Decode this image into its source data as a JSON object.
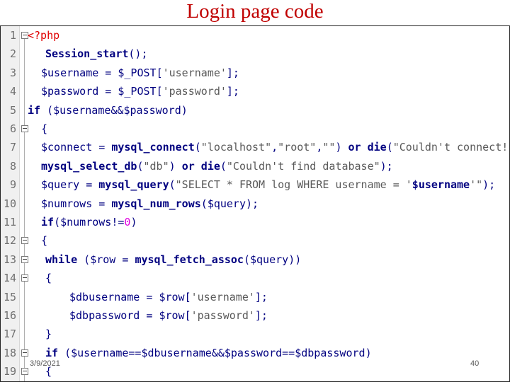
{
  "title": "Login page code",
  "footer": {
    "date": "3/9/2021",
    "page": "40"
  },
  "lines": [
    {
      "n": "1",
      "indent": 0,
      "fold": true,
      "tokens": [
        [
          "php",
          "<?php"
        ]
      ]
    },
    {
      "n": "2",
      "indent": 2,
      "fold": false,
      "tokens": [
        [
          "fn",
          "Session_start"
        ],
        [
          "op",
          "();"
        ]
      ]
    },
    {
      "n": "3",
      "indent": 1,
      "fold": false,
      "tokens": [
        [
          "var",
          "$username"
        ],
        [
          "op",
          " = "
        ],
        [
          "var",
          "$_POST"
        ],
        [
          "op",
          "["
        ],
        [
          "str",
          "'username'"
        ],
        [
          "op",
          "];"
        ]
      ]
    },
    {
      "n": "4",
      "indent": 1,
      "fold": false,
      "tokens": [
        [
          "var",
          "$password"
        ],
        [
          "op",
          " = "
        ],
        [
          "var",
          "$_POST"
        ],
        [
          "op",
          "["
        ],
        [
          "str",
          "'password'"
        ],
        [
          "op",
          "];"
        ]
      ]
    },
    {
      "n": "5",
      "indent": 0,
      "fold": false,
      "tokens": [
        [
          "kw",
          "if"
        ],
        [
          "op",
          " ("
        ],
        [
          "var",
          "$username"
        ],
        [
          "op",
          "&&"
        ],
        [
          "var",
          "$password"
        ],
        [
          "op",
          ")"
        ]
      ]
    },
    {
      "n": "6",
      "indent": 1,
      "fold": true,
      "tokens": [
        [
          "op",
          "{"
        ]
      ]
    },
    {
      "n": "7",
      "indent": 1,
      "fold": false,
      "tokens": [
        [
          "var",
          "$connect"
        ],
        [
          "op",
          " = "
        ],
        [
          "fn",
          "mysql_connect"
        ],
        [
          "op",
          "("
        ],
        [
          "str",
          "\"localhost\""
        ],
        [
          "op",
          ","
        ],
        [
          "str",
          "\"root\""
        ],
        [
          "op",
          ","
        ],
        [
          "str",
          "\"\""
        ],
        [
          "op",
          ") "
        ],
        [
          "kw",
          "or"
        ],
        [
          "op",
          " "
        ],
        [
          "fn",
          "die"
        ],
        [
          "op",
          "("
        ],
        [
          "str",
          "\"Couldn't connect!\""
        ],
        [
          "op",
          ");"
        ]
      ]
    },
    {
      "n": "8",
      "indent": 1,
      "fold": false,
      "tokens": [
        [
          "fn",
          "mysql_select_db"
        ],
        [
          "op",
          "("
        ],
        [
          "str",
          "\"db\""
        ],
        [
          "op",
          ") "
        ],
        [
          "kw",
          "or"
        ],
        [
          "op",
          " "
        ],
        [
          "fn",
          "die"
        ],
        [
          "op",
          "("
        ],
        [
          "str",
          "\"Couldn't find database\""
        ],
        [
          "op",
          ");"
        ]
      ]
    },
    {
      "n": "9",
      "indent": 1,
      "fold": false,
      "tokens": [
        [
          "var",
          "$query"
        ],
        [
          "op",
          " = "
        ],
        [
          "fn",
          "mysql_query"
        ],
        [
          "op",
          "("
        ],
        [
          "str",
          "\"SELECT * FROM log WHERE username = '"
        ],
        [
          "fn",
          "$username"
        ],
        [
          "str",
          "'\""
        ],
        [
          "op",
          ");"
        ]
      ]
    },
    {
      "n": "10",
      "indent": 1,
      "fold": false,
      "tokens": [
        [
          "var",
          "$numrows"
        ],
        [
          "op",
          " = "
        ],
        [
          "fn",
          "mysql_num_rows"
        ],
        [
          "op",
          "("
        ],
        [
          "var",
          "$query"
        ],
        [
          "op",
          ");"
        ]
      ]
    },
    {
      "n": "11",
      "indent": 1,
      "fold": false,
      "tokens": [
        [
          "kw",
          "if"
        ],
        [
          "op",
          "("
        ],
        [
          "var",
          "$numrows"
        ],
        [
          "op",
          "!="
        ],
        [
          "num",
          "0"
        ],
        [
          "op",
          ")"
        ]
      ]
    },
    {
      "n": "12",
      "indent": 1,
      "fold": true,
      "tokens": [
        [
          "op",
          "{"
        ]
      ]
    },
    {
      "n": "13",
      "indent": 2,
      "fold": true,
      "tokens": [
        [
          "kw",
          "while"
        ],
        [
          "op",
          " ("
        ],
        [
          "var",
          "$row"
        ],
        [
          "op",
          " = "
        ],
        [
          "fn",
          "mysql_fetch_assoc"
        ],
        [
          "op",
          "("
        ],
        [
          "var",
          "$query"
        ],
        [
          "op",
          "))"
        ]
      ]
    },
    {
      "n": "14",
      "indent": 2,
      "fold": true,
      "tokens": [
        [
          "op",
          "{"
        ]
      ]
    },
    {
      "n": "15",
      "indent": 3,
      "fold": false,
      "tokens": [
        [
          "var",
          "$dbusername"
        ],
        [
          "op",
          " = "
        ],
        [
          "var",
          "$row"
        ],
        [
          "op",
          "["
        ],
        [
          "str",
          "'username'"
        ],
        [
          "op",
          "];"
        ]
      ]
    },
    {
      "n": "16",
      "indent": 3,
      "fold": false,
      "tokens": [
        [
          "var",
          "$dbpassword"
        ],
        [
          "op",
          " = "
        ],
        [
          "var",
          "$row"
        ],
        [
          "op",
          "["
        ],
        [
          "str",
          "'password'"
        ],
        [
          "op",
          "];"
        ]
      ]
    },
    {
      "n": "17",
      "indent": 2,
      "fold": false,
      "tokens": [
        [
          "op",
          "}"
        ]
      ]
    },
    {
      "n": "18",
      "indent": 2,
      "fold": true,
      "tokens": [
        [
          "kw",
          "if"
        ],
        [
          "op",
          " ("
        ],
        [
          "var",
          "$username"
        ],
        [
          "op",
          "=="
        ],
        [
          "var",
          "$dbusername"
        ],
        [
          "op",
          "&&"
        ],
        [
          "var",
          "$password"
        ],
        [
          "op",
          "=="
        ],
        [
          "var",
          "$dbpassword"
        ],
        [
          "op",
          ")"
        ]
      ]
    },
    {
      "n": "19",
      "indent": 2,
      "fold": true,
      "tokens": [
        [
          "op",
          "{"
        ]
      ]
    }
  ]
}
